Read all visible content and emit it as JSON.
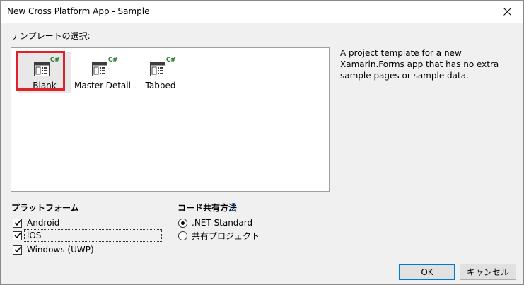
{
  "window": {
    "title": "New Cross Platform App - Sample"
  },
  "templates_section": {
    "label": "テンプレートの選択:",
    "items": [
      {
        "label": "Blank",
        "badge": "C#",
        "selected": true
      },
      {
        "label": "Master-Detail",
        "badge": "C#",
        "selected": false
      },
      {
        "label": "Tabbed",
        "badge": "C#",
        "selected": false
      }
    ],
    "description": "A project template for a new Xamarin.Forms app that has no extra sample pages or sample data."
  },
  "platform_section": {
    "label": "プラットフォーム",
    "options": [
      {
        "label": "Android",
        "checked": true
      },
      {
        "label": "iOS",
        "checked": true
      },
      {
        "label": "Windows (UWP)",
        "checked": true
      }
    ]
  },
  "code_sharing_section": {
    "label": "コード共有方法",
    "help": "?",
    "options": [
      {
        "label": ".NET Standard",
        "selected": true
      },
      {
        "label": "共有プロジェクト",
        "selected": false
      }
    ]
  },
  "buttons": {
    "ok": "OK",
    "cancel": "キャンセル"
  },
  "colors": {
    "selection_highlight": "#e0202a",
    "csharp_badge": "#2e7d32",
    "link": "#1a5fb4",
    "primary_border": "#0078d7"
  },
  "icons": {
    "close": "close-icon",
    "template": "form-template-icon",
    "check": "checkmark-icon"
  }
}
